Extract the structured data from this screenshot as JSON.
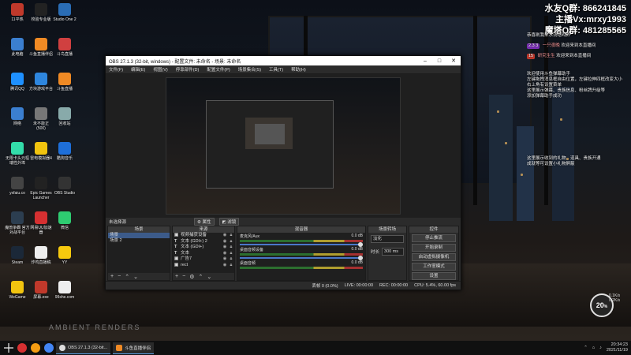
{
  "desktop_icons": [
    {
      "label": "11平热",
      "color": "#c0392b"
    },
    {
      "label": "校验专业版",
      "color": "#222"
    },
    {
      "label": "Studio One 2",
      "color": "#2a6db5"
    },
    {
      "label": "此电脑",
      "color": "#3b7fd0"
    },
    {
      "label": "斗鱼直播伴侣",
      "color": "#f08a24"
    },
    {
      "label": "斗鸟直播",
      "color": "#d04040"
    },
    {
      "label": "腾讯QQ",
      "color": "#1e90ff"
    },
    {
      "label": "方块游戏平台",
      "color": "#2e86de"
    },
    {
      "label": "斗鱼直播",
      "color": "#f08a24"
    },
    {
      "label": "网络",
      "color": "#3b7fd0"
    },
    {
      "label": "未不能正 (500)",
      "color": "#777"
    },
    {
      "label": "回收站",
      "color": "#8aa"
    },
    {
      "label": "无限卡头元桓 瑞性外埠",
      "color": "#3da"
    },
    {
      "label": "雷电模拟器4",
      "color": "#f1c40f"
    },
    {
      "label": "酷狗音乐",
      "color": "#1e6fd9"
    },
    {
      "label": "yxfaiu.co",
      "color": "#444"
    },
    {
      "label": "Epic Games Launcher",
      "color": "#222"
    },
    {
      "label": "OBS Studio",
      "color": "#333"
    },
    {
      "label": "魔兽争霸 官方对战平台",
      "color": "#2c3e50"
    },
    {
      "label": "网易UU加速器",
      "color": "#d63031"
    },
    {
      "label": "微信",
      "color": "#2ecc71"
    },
    {
      "label": "Steam",
      "color": "#1b2838"
    },
    {
      "label": "炸鸡直播稿",
      "color": "#eee"
    },
    {
      "label": "YY",
      "color": "#f6c90e"
    },
    {
      "label": "WeGame",
      "color": "#f1c40f"
    },
    {
      "label": "屏幕.exe",
      "color": "#c0392b"
    },
    {
      "label": "99she.com",
      "color": "#eee"
    }
  ],
  "overlay": {
    "line1": "水友Q群: 866241845",
    "line2": "主播Vx:mrxy1993",
    "line3": "魔塔Q群: 481285565"
  },
  "chat": {
    "header": "恭喜刷我来水浇培鸡养",
    "messages": [
      {
        "badge": "2.3 3",
        "badge_color": "#7b2fb5",
        "user": "一只夜晚",
        "text": "欢迎来到本直播间"
      },
      {
        "badge": "15",
        "badge_color": "#c0392b",
        "user": "研究生生",
        "text": "欢迎来到本直播间"
      }
    ],
    "notice_lines": [
      "欢迎使用斗鱼弹幕助手",
      "左键拖拽消息框自由位置，左键拉伸四框改变大小",
      "右上角有设置菜单",
      "这里展示弹幕、贵族信息、粉丝牌升级等",
      "添加弹幕助手成功"
    ],
    "gift_lines": [
      "这里展示收到的礼物、道具、贵族开通",
      "成就等可设置小礼物屏蔽"
    ]
  },
  "ambient_text": "AMBIENT RENDERS",
  "obs": {
    "title": "OBS 27.1.3 (32-bit, windows) - 配置文件: 未命名 - 场景: 未命名",
    "menu": [
      "文件(F)",
      "编辑(E)",
      "视图(V)",
      "停靠部件(D)",
      "配置文件(P)",
      "场景集合(S)",
      "工具(T)",
      "帮助(H)"
    ],
    "no_source": "未选择源",
    "props_label": "属性",
    "filters_label": "滤镜",
    "docks": {
      "scenes": {
        "title": "场景",
        "items": [
          "场景",
          "场景 2"
        ]
      },
      "sources": {
        "title": "来源",
        "items": [
          {
            "type": "▣",
            "name": "视频捕获设备"
          },
          {
            "type": "T",
            "name": "文本 (GDI+) 2"
          },
          {
            "type": "T",
            "name": "文本 (GDI+)"
          },
          {
            "type": "T",
            "name": "文本"
          },
          {
            "type": "▣",
            "name": "广告7"
          },
          {
            "type": "▣",
            "name": "rect"
          }
        ]
      },
      "mixer": {
        "title": "混音器",
        "channels": [
          {
            "name": "麦克风/Aux",
            "db": "0.0 dB"
          },
          {
            "name": "桌面音频设备",
            "db": "0.0 dB"
          },
          {
            "name": "桌面音频",
            "db": "0.0 dB"
          }
        ]
      },
      "transitions": {
        "title": "场景转场",
        "type": "淡化",
        "duration_label": "时长",
        "duration": "300 ms"
      },
      "controls": {
        "title": "控件",
        "buttons": [
          "停止推流",
          "开始录制",
          "启动虚拟摄像机",
          "工作室模式",
          "设置",
          "退出"
        ]
      }
    },
    "statusbar": {
      "dropped": "丢帧 0 (0.0%)",
      "live": "LIVE: 00:00:00",
      "rec": "REC: 00:00:00",
      "cpu": "CPU: 5.4%, 60.00 fps"
    }
  },
  "widget": {
    "value": "20",
    "unit": "%",
    "line1": "0.1K/s",
    "line2": "0.2K/s"
  },
  "taskbar": {
    "apps": [
      "OBS 27.1.3 (32-bit...",
      "斗鱼直播伴侣"
    ],
    "time": "20:34:23",
    "date": "2021/11/19"
  }
}
